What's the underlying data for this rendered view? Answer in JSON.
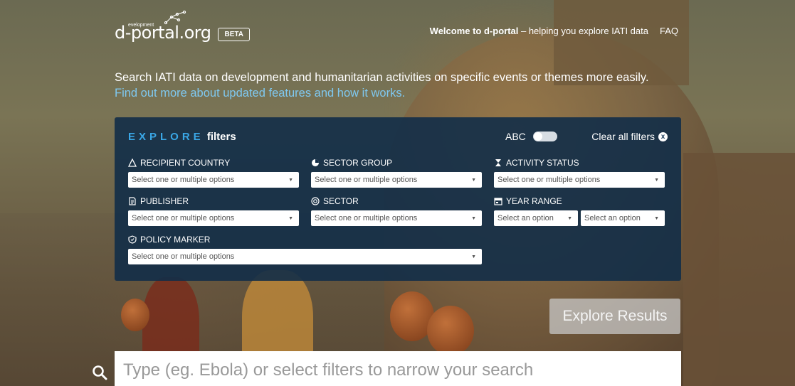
{
  "logo": {
    "small": "evelopment",
    "main": "d-portal.org",
    "badge": "BETA"
  },
  "nav": {
    "welcome_bold": "Welcome to d-portal",
    "welcome_rest": " – helping you explore IATI data",
    "faq": "FAQ"
  },
  "intro": {
    "line1": "Search IATI data on development and humanitarian activities on specific events or themes more easily.",
    "link": "Find out more about updated features and how it works."
  },
  "explore": {
    "title_a": "EXPLORE",
    "title_b": " filters",
    "abc_label": "ABC",
    "clear_label": "Clear all filters",
    "clear_icon": "x",
    "filters": {
      "recipient_country": {
        "label": "RECIPIENT COUNTRY",
        "placeholder": "Select one or multiple options",
        "icon": "triangle-icon"
      },
      "sector_group": {
        "label": "SECTOR GROUP",
        "placeholder": "Select one or multiple options",
        "icon": "pie-icon"
      },
      "activity_status": {
        "label": "ACTIVITY STATUS",
        "placeholder": "Select one or multiple options",
        "icon": "hourglass-icon"
      },
      "publisher": {
        "label": "PUBLISHER",
        "placeholder": "Select one or multiple options",
        "icon": "document-icon"
      },
      "sector": {
        "label": "SECTOR",
        "placeholder": "Select one or multiple options",
        "icon": "target-icon"
      },
      "year_range": {
        "label": "YEAR RANGE",
        "from_placeholder": "Select an option",
        "to_placeholder": "Select an option",
        "icon": "calendar-icon"
      },
      "policy_marker": {
        "label": "POLICY MARKER",
        "placeholder": "Select one or multiple options",
        "icon": "shield-icon"
      }
    }
  },
  "explore_button": "Explore Results",
  "search": {
    "placeholder": "Type (eg. Ebola) or select filters to narrow your search"
  },
  "colors": {
    "panel": "#122d48",
    "accent": "#3aa7e6",
    "link": "#7fc8f0"
  }
}
